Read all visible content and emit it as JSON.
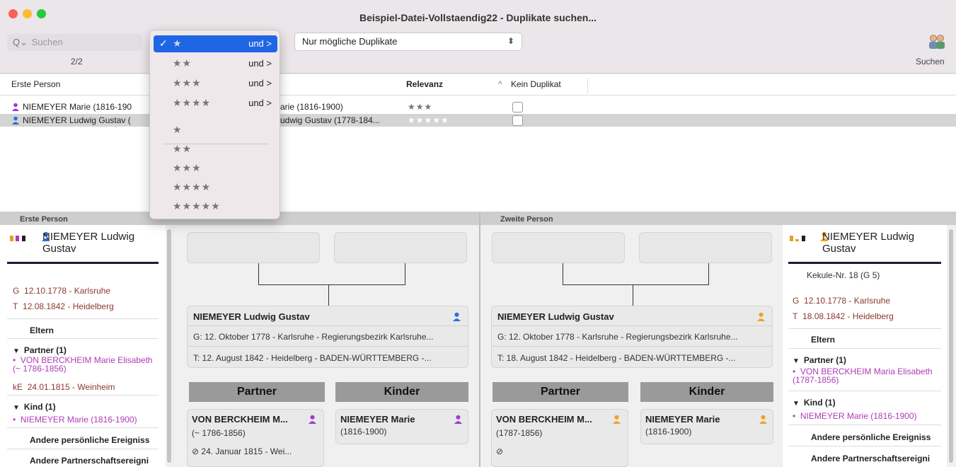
{
  "window": {
    "title": "Beispiel-Datei-Vollstaendig22 - Duplikate suchen...",
    "traffic_colors": [
      "#fe5f57",
      "#febc2e",
      "#28c840"
    ]
  },
  "toolbar": {
    "search_placeholder": "Suchen",
    "search_icon": "magnifier-icon",
    "counter": "2/2",
    "filter_value": "Nur mögliche Duplikate",
    "search_button_label": "Suchen",
    "search_button_icon": "people-search-icon"
  },
  "relevance_menu": {
    "selected_index": 0,
    "items": [
      {
        "stars": "★",
        "suffix": "und >"
      },
      {
        "stars": "★★",
        "suffix": "und >"
      },
      {
        "stars": "★★★",
        "suffix": "und >"
      },
      {
        "stars": "★★★★",
        "suffix": "und >"
      },
      {
        "stars": "★",
        "suffix": ""
      },
      {
        "stars": "★★",
        "suffix": ""
      },
      {
        "stars": "★★★",
        "suffix": ""
      },
      {
        "stars": "★★★★",
        "suffix": ""
      },
      {
        "stars": "★★★★★",
        "suffix": ""
      }
    ],
    "checkmark": "✓"
  },
  "table": {
    "headers": {
      "first": "Erste Person",
      "relevance": "Relevanz",
      "sort_icon": "^",
      "not_dup": "Kein Duplikat"
    },
    "rows": [
      {
        "first": "NIEMEYER Marie (1816-190",
        "second": "arie (1816-1900)",
        "relevance": "★★★",
        "first_color": "#a13ad1",
        "selected": false
      },
      {
        "first": "NIEMEYER Ludwig Gustav (",
        "second": "udwig Gustav (1778-184...",
        "relevance": "★★★★★",
        "first_color": "#2a6fd8",
        "selected": true
      }
    ]
  },
  "left_panel": {
    "section": "Erste Person",
    "name": "NIEMEYER Ludwig Gustav",
    "events": [
      {
        "code": "G",
        "text": "12.10.1778 - Karlsruhe"
      },
      {
        "code": "T",
        "text": "12.08.1842 - Heidelberg"
      }
    ],
    "eltern": "Eltern",
    "partner_label": "Partner (1)",
    "partner_name": "VON BERCKHEIM Marie Elisabeth (~ 1786-1856)",
    "marriage": {
      "code": "kE",
      "text": "24.01.1815 - Weinheim"
    },
    "kind_label": "Kind (1)",
    "kind_name": "NIEMEYER Marie (1816-1900)",
    "other1": "Andere persönliche Ereigniss",
    "other2": "Andere Partnerschaftsereigni"
  },
  "left_tree": {
    "person_title": "NIEMEYER Ludwig Gustav",
    "birth": "G: 12. Oktober 1778 - Karlsruhe - Regierungsbezirk Karlsruhe...",
    "death": "T: 12. August 1842 - Heidelberg - BADEN-WÜRTTEMBERG -...",
    "partner_head": "Partner",
    "kinder_head": "Kinder",
    "partner_card": {
      "name": "VON BERCKHEIM M...",
      "dates": "(~ 1786-1856)",
      "marriage": "24. Januar 1815 - Wei..."
    },
    "child_card": {
      "name": "NIEMEYER Marie",
      "dates": "(1816-1900)"
    }
  },
  "right_tree": {
    "section": "Zweite Person",
    "person_title": "NIEMEYER Ludwig Gustav",
    "birth": "G: 12. Oktober 1778 - Karlsruhe - Regierungsbezirk Karlsruhe...",
    "death": "T: 18. August 1842 - Heidelberg - BADEN-WÜRTTEMBERG -...",
    "partner_head": "Partner",
    "kinder_head": "Kinder",
    "partner_card": {
      "name": "VON BERCKHEIM M...",
      "dates": "(1787-1856)"
    },
    "child_card": {
      "name": "NIEMEYER Marie",
      "dates": "(1816-1900)"
    }
  },
  "right_panel": {
    "name": "NIEMEYER Ludwig Gustav",
    "kekule": "Kekule-Nr. 18 (G 5)",
    "events": [
      {
        "code": "G",
        "text": "12.10.1778 - Karlsruhe"
      },
      {
        "code": "T",
        "text": "18.08.1842 - Heidelberg"
      }
    ],
    "eltern": "Eltern",
    "partner_label": "Partner (1)",
    "partner_name": "VON BERCKHEIM Maria Elisabeth (1787-1856)",
    "kind_label": "Kind (1)",
    "kind_name": "NIEMEYER Marie (1816-1900)",
    "other1": "Andere persönliche Ereigniss",
    "other2": "Andere Partnerschaftsereigni"
  },
  "colors": {
    "female": "#a13ad1",
    "male": "#2a6fd8",
    "male_orange": "#f0a020",
    "highlight": "#1f66e5"
  }
}
